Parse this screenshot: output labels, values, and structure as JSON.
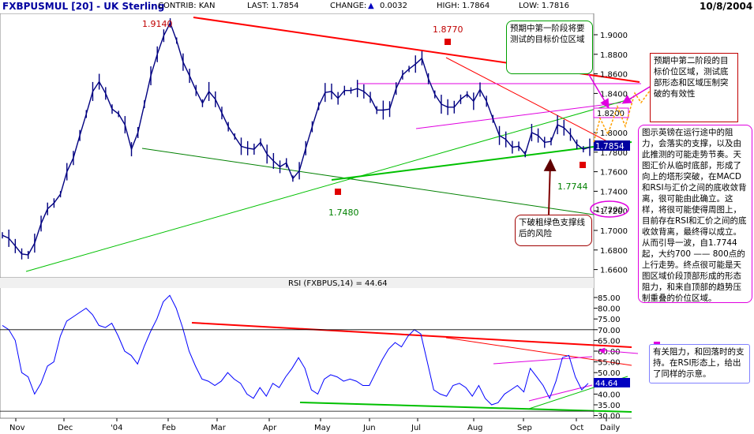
{
  "header": {
    "symbol": "FXBPUSMUL [20] - UK Sterling",
    "contrib": "CONTRIB: KAN",
    "last": "LAST: 1.7854",
    "change_label": "CHANGE:",
    "change_value": "0.0032",
    "high": "HIGH: 1.7864",
    "low": "LOW: 1.7816",
    "date": "10/8/2004"
  },
  "chart_data": [
    {
      "type": "line",
      "title": "",
      "ylim": [
        1.65,
        1.92
      ],
      "y_ticks": [
        "1.9000",
        "1.8800",
        "1.8600",
        "1.8400",
        "1.8200",
        "1.8000",
        "1.7800",
        "1.7600",
        "1.7400",
        "1.7200",
        "1.7000",
        "1.6800",
        "1.6600"
      ],
      "x_ticks": [
        "Nov",
        "Dec",
        "'04",
        "Feb",
        "Mar",
        "Apr",
        "May",
        "Jun",
        "Jul",
        "Aug",
        "Sep",
        "Oct",
        "Daily"
      ],
      "series": [
        {
          "values": [
            1.695,
            1.692,
            1.684,
            1.676,
            1.675,
            1.687,
            1.707,
            1.722,
            1.728,
            1.737,
            1.76,
            1.774,
            1.797,
            1.819,
            1.842,
            1.852,
            1.84,
            1.824,
            1.819,
            1.808,
            1.783,
            1.8,
            1.829,
            1.858,
            1.88,
            1.899,
            1.912,
            1.894,
            1.872,
            1.858,
            1.843,
            1.83,
            1.842,
            1.834,
            1.82,
            1.806,
            1.796,
            1.786,
            1.784,
            1.783,
            1.79,
            1.778,
            1.771,
            1.765,
            1.769,
            1.753,
            1.761,
            1.784,
            1.806,
            1.827,
            1.841,
            1.842,
            1.835,
            1.843,
            1.843,
            1.845,
            1.842,
            1.836,
            1.823,
            1.823,
            1.824,
            1.845,
            1.859,
            1.865,
            1.87,
            1.876,
            1.855,
            1.839,
            1.829,
            1.826,
            1.826,
            1.834,
            1.839,
            1.832,
            1.844,
            1.832,
            1.814,
            1.797,
            1.793,
            1.785,
            1.786,
            1.778,
            1.8,
            1.797,
            1.79,
            1.791,
            1.808,
            1.805,
            1.798,
            1.788,
            1.783,
            1.785
          ]
        }
      ],
      "price_labels": [
        "1.9140",
        "1.8770",
        "1.7480",
        "1.7744",
        "1.7854"
      ],
      "level_labels": [
        "1.8200",
        "1.7200"
      ]
    },
    {
      "type": "line",
      "title": "RSI (FXBPUS,14) = 44.64",
      "ylim": [
        30,
        88
      ],
      "y_ticks": [
        "85.00",
        "80.00",
        "75.00",
        "70.00",
        "65.00",
        "60.00",
        "55.00",
        "50.00",
        "45.00",
        "40.00",
        "35.00",
        "30.00"
      ],
      "series": [
        {
          "values": [
            72,
            70,
            65,
            50,
            48,
            40,
            45,
            53,
            55,
            67,
            74,
            76,
            78,
            80,
            77,
            72,
            71,
            73,
            67,
            60,
            58,
            54,
            62,
            69,
            75,
            83,
            86,
            80,
            71,
            60,
            53,
            47,
            46,
            44,
            46,
            50,
            47,
            45,
            40,
            38,
            43,
            39,
            45,
            43,
            48,
            52,
            57,
            52,
            42,
            40,
            47,
            49,
            48,
            46,
            47,
            46,
            44,
            44,
            50,
            56,
            61,
            64,
            62,
            67,
            70,
            68,
            55,
            42,
            40,
            39,
            44,
            45,
            43,
            39,
            44,
            38,
            35,
            36,
            40,
            42,
            44,
            41,
            52,
            48,
            44,
            38,
            46,
            57,
            58,
            48,
            42,
            45
          ]
        }
      ],
      "value_label": "44.64"
    }
  ],
  "annotations": {
    "n1": "预期中第一阶段将要测试的目标价位区域",
    "n2": "预期中第二阶段的目标价位区域，测试底部形态和区域压制突破的有效性",
    "n3": "图示英镑在运行途中的阻力，会落实的支撑，以及由此推测的可能走势节奏。天图汇价从临时底部，形成了向上的塔形突破，在MACD和RSI与汇价之间的底收敛背离，很可能由此确立。这样，将很可能使得周图上，目前存在RSI和汇价之间的底收敛背离，最终得以成立。从而引导一波，自1.7744起，大约700 —— 800点的上行走势。终点很可能是天图区域价段顶部形成的形态阻力，和来自顶部的趋势压制重叠的价位区域。",
    "n4": "下破粗绿色支撑线后的风险",
    "n5": "有关阻力，和回落时的支持。在RSI形态上，给出了同样的示意。"
  },
  "colors": {
    "price_line": "#000080",
    "rsi_line": "#0000ff",
    "resistance": "#ff0000",
    "support": "#00c000",
    "channel": "#e000e0",
    "arrow_up": "#ffa000",
    "arrow_dark": "#800000"
  }
}
